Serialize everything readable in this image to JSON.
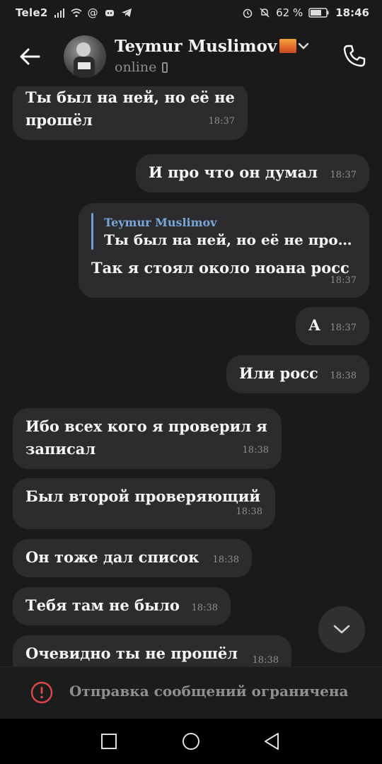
{
  "status_bar": {
    "carrier": "Tele2",
    "battery": "62 %",
    "time": "18:46",
    "icons": [
      "signal-icon",
      "wifi-icon",
      "at-icon",
      "discord-icon",
      "telegram-icon",
      "alarm-icon",
      "mute-icon",
      "battery-icon"
    ]
  },
  "header": {
    "name": "Teymur Muslimov",
    "status": "online"
  },
  "messages": [
    {
      "text_1": "Ты был на ней, но её не",
      "text_2": "прошёл",
      "time": "18:37"
    },
    {
      "text": "И про что он думал",
      "time": "18:37"
    },
    {
      "reply_name": "Teymur Muslimov",
      "reply_text": "Ты был на ней, но её не про…",
      "text": "Так я стоял около ноана росс",
      "time": "18:37"
    },
    {
      "text": "А",
      "time": "18:37"
    },
    {
      "text": "Или росс",
      "time": "18:38"
    },
    {
      "text_1": "Ибо всех кого я проверил я",
      "text_2": "записал",
      "time": "18:38"
    },
    {
      "text": "Был второй проверяющий",
      "time": "18:38"
    },
    {
      "text": "Он тоже дал список",
      "time": "18:38"
    },
    {
      "text": "Тебя там не было",
      "time": "18:38"
    },
    {
      "text": "Очевидно ты не прошёл",
      "time": "18:38"
    }
  ],
  "restriction": {
    "text": "Отправка сообщений ограничена"
  },
  "colors": {
    "background": "#1a1a1a",
    "bubble": "#2c2c2e",
    "reply_accent": "#7aa7da",
    "warning": "#e0454a"
  }
}
